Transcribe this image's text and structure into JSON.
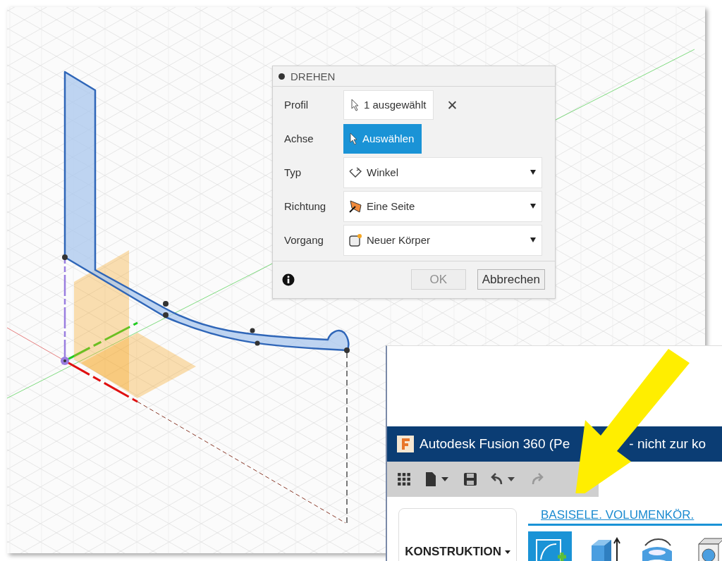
{
  "dialog": {
    "title": "DREHEN",
    "rows": [
      {
        "kind": "selection",
        "label": "Profil",
        "value": "1 ausgewählt",
        "clear": "✕"
      },
      {
        "kind": "picker",
        "label": "Achse",
        "value": "Auswählen",
        "active": true
      },
      {
        "kind": "dropdown",
        "label": "Typ",
        "value": "Winkel"
      },
      {
        "kind": "dropdown",
        "label": "Richtung",
        "value": "Eine Seite"
      },
      {
        "kind": "dropdown",
        "label": "Vorgang",
        "value": "Neuer Körper"
      }
    ],
    "buttons": [
      {
        "label": "OK",
        "disabled": true
      },
      {
        "label": "Abbrechen",
        "disabled": false
      }
    ]
  },
  "inset": {
    "title_start": "Autodesk Fusion 360 (Pe",
    "title_end": "- nicht zur ko",
    "workspace": "KONSTRUKTION",
    "ribbon_tabs": [
      {
        "label": "BASISELE. VOLUMENKÖR.",
        "selected": true
      }
    ],
    "tools": [
      {
        "selected": true
      },
      {
        "selected": false
      },
      {
        "selected": false
      },
      {
        "selected": false
      }
    ]
  }
}
